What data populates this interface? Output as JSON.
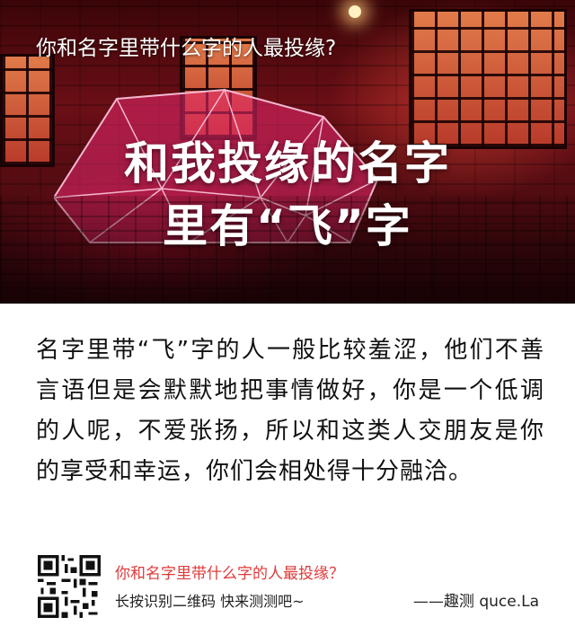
{
  "hero": {
    "top_title": "你和名字里带什么字的人最投缘?",
    "headline_line1": "和我投缘的名字",
    "headline_line2": "里有“飞”字",
    "accent_color": "#6b0f16"
  },
  "body": {
    "text": "名字里带“飞”字的人一般比较羞涩，他们不善言语但是会默默地把事情做好，你是一个低调的人呢，不爱张扬，所以和这类人交朋友是你的享受和幸运，你们会相处得十分融洽。"
  },
  "footer": {
    "qr_icon": "qr-code-icon",
    "title": "你和名字里带什么字的人最投缘？",
    "subtitle": "长按识别二维码  快来测测吧~",
    "credit": "——趣测 quce.La",
    "title_color": "#e03a3a"
  }
}
